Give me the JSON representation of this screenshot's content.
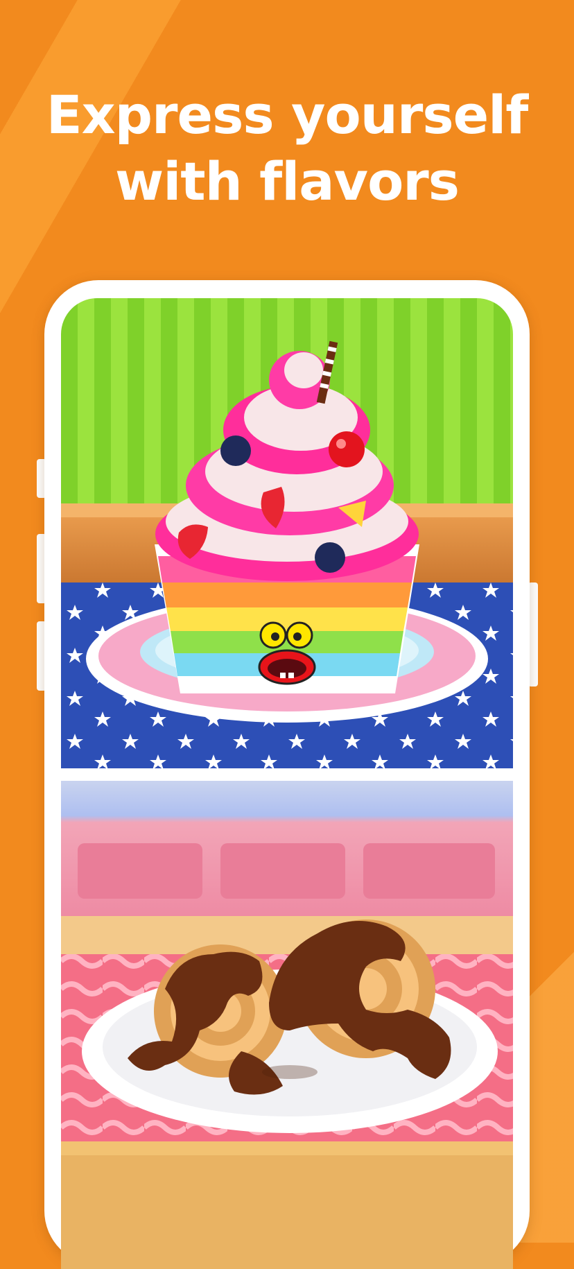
{
  "headline": {
    "line1": "Express yourself",
    "line2": "with flavors"
  },
  "colors": {
    "background": "#f28a1e",
    "headline_text": "#ffffff",
    "phone_frame": "#ffffff"
  },
  "screens": [
    {
      "scene": "cupcake-decorating"
    },
    {
      "scene": "churros-with-chocolate"
    }
  ]
}
